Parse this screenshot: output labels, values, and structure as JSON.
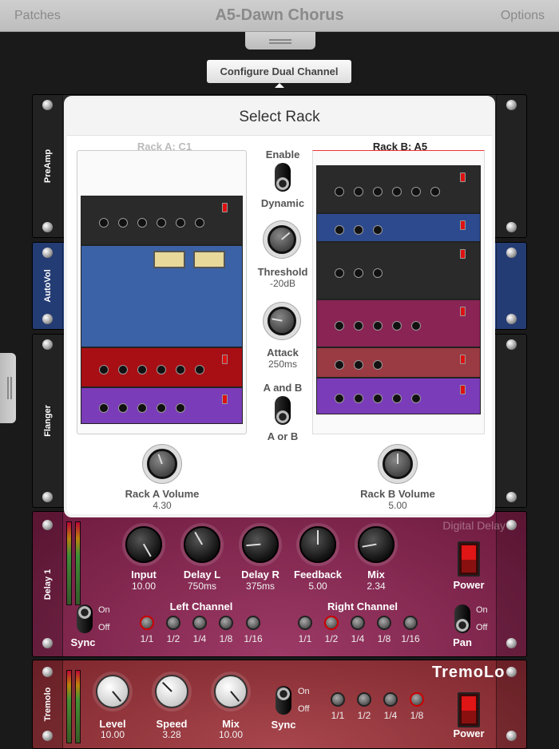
{
  "header": {
    "left": "Patches",
    "title": "A5-Dawn Chorus",
    "right": "Options"
  },
  "configure_button": "Configure Dual Channel",
  "background_racks": [
    "PreAmp",
    "AutoVol",
    "Flanger"
  ],
  "popup": {
    "title": "Select Rack",
    "rack_a": {
      "label": "Rack A: C1",
      "volume_label": "Rack A Volume",
      "volume_value": "4.30",
      "volume": 4.3
    },
    "rack_b": {
      "label": "Rack B: A5",
      "volume_label": "Rack B Volume",
      "volume_value": "5.00",
      "volume": 5.0
    },
    "enable_label": "Enable",
    "dynamic_label": "Dynamic",
    "threshold_label": "Threshold",
    "threshold_value": "-20dB",
    "attack_label": "Attack",
    "attack_value": "250ms",
    "mode_on_label": "A and B",
    "mode_off_label": "A or B"
  },
  "delay": {
    "name": "Delay 1",
    "brand": "Digital Delay",
    "knobs": [
      {
        "label": "Input",
        "value": "10.00"
      },
      {
        "label": "Delay L",
        "value": "750ms"
      },
      {
        "label": "Delay R",
        "value": "375ms"
      },
      {
        "label": "Feedback",
        "value": "5.00"
      },
      {
        "label": "Mix",
        "value": "2.34"
      }
    ],
    "power_label": "Power",
    "sync_label": "Sync",
    "pan_label": "Pan",
    "on": "On",
    "off": "Off",
    "left_channel": "Left Channel",
    "right_channel": "Right Channel",
    "divisions": [
      "1/1",
      "1/2",
      "1/4",
      "1/8",
      "1/16"
    ],
    "left_selected": "1/1",
    "right_selected": "1/2"
  },
  "tremolo": {
    "name": "Tremolo",
    "brand": "TremoLo",
    "knobs": [
      {
        "label": "Level",
        "value": "10.00"
      },
      {
        "label": "Speed",
        "value": "3.28"
      },
      {
        "label": "Mix",
        "value": "10.00"
      }
    ],
    "sync_label": "Sync",
    "on": "On",
    "off": "Off",
    "power_label": "Power",
    "divisions": [
      "1/1",
      "1/2",
      "1/4",
      "1/8"
    ],
    "selected": "1/8"
  },
  "colors": {
    "delay": "#7b1f47",
    "tremolo": "#8c2f36",
    "autovol": "#2d4a8e",
    "dark": "#2a2a2a"
  }
}
